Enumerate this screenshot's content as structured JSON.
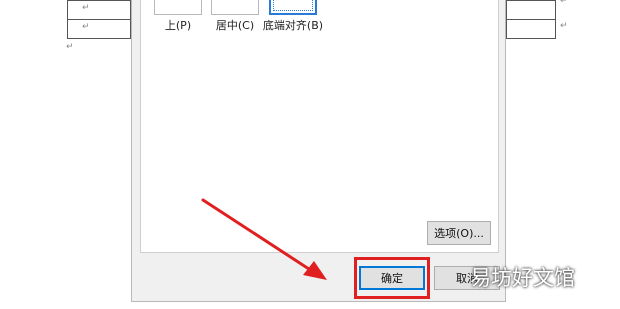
{
  "document": {
    "table_marks": [
      "↵",
      "↵"
    ],
    "para_mark": "↵"
  },
  "dialog": {
    "alignment_options": [
      {
        "label": "上(P)",
        "selected": false
      },
      {
        "label": "居中(C)",
        "selected": false
      },
      {
        "label": "底端对齐(B)",
        "selected": true
      }
    ],
    "options_button": "选项(O)...",
    "ok_button": "确定",
    "cancel_button": "取消"
  },
  "annotation": {
    "arrow_color": "#e02020",
    "highlight_color": "#e02020"
  },
  "watermark": "易坊好文馆"
}
